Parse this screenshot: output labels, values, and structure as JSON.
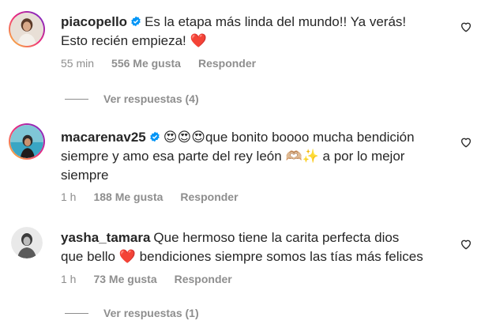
{
  "comments": [
    {
      "username": "piacopello",
      "verified": true,
      "text_line1": "Es la etapa más linda del mundo!! Ya verás!",
      "text_line2": "Esto recién empieza!",
      "heart": "❤️",
      "time": "55 min",
      "likes": "556 Me gusta",
      "reply": "Responder",
      "replies_label": "Ver respuestas (4)"
    },
    {
      "username": "macarenav25",
      "verified": true,
      "emojis": "😍😍😍",
      "text_line1": "que bonito boooo mucha bendición",
      "text_line2": "siempre y amo esa parte del rey león",
      "hands_emoji": "🫶🏼✨",
      "text_line2b": "a por lo mejor",
      "text_line3": "siempre",
      "time": "1 h",
      "likes": "188 Me gusta",
      "reply": "Responder"
    },
    {
      "username": "yasha_tamara",
      "verified": false,
      "text_line1": "Que hermoso tiene la carita perfecta dios",
      "text_line2a": "que bello",
      "heart": "❤️",
      "text_line2b": "bendiciones siempre somos las tías más felices",
      "time": "1 h",
      "likes": "73 Me gusta",
      "reply": "Responder",
      "replies_label": "Ver respuestas (1)"
    }
  ],
  "colors": {
    "text": "#262626",
    "secondary": "#8e8e8e",
    "verified": "#0095f6",
    "heart": "#ed1c3a"
  },
  "icons": [
    "verified-badge-icon",
    "heart-outline-icon",
    "avatar"
  ]
}
